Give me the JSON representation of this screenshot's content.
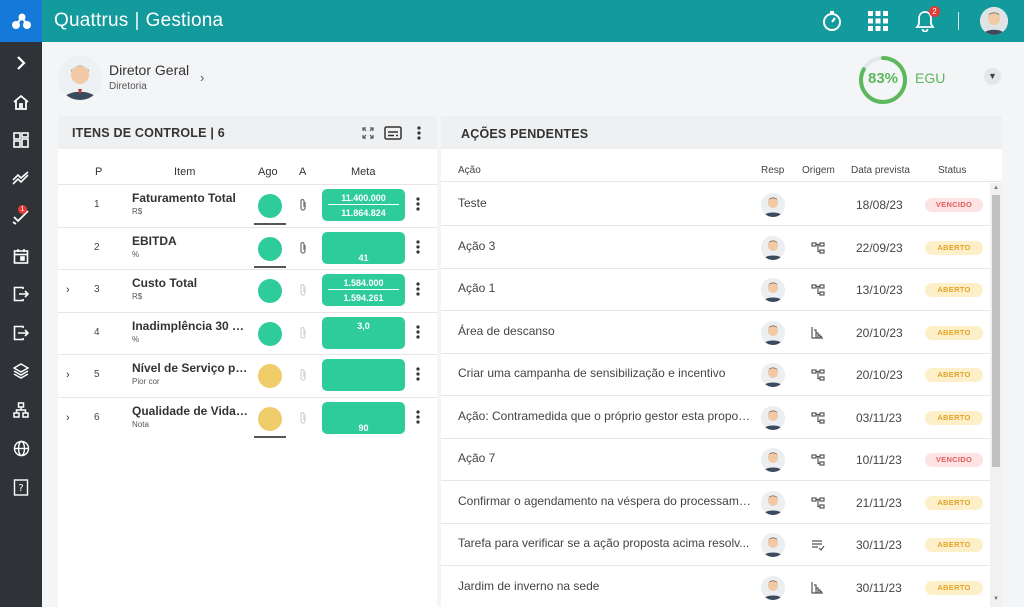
{
  "app": {
    "brand": "Quattrus",
    "module": "Gestiona",
    "notification_count": "2"
  },
  "colors": {
    "topbar": "#139a9c",
    "sidebar": "#2f3338",
    "green": "#2ecc9a",
    "yellow": "#f0cd6b",
    "gauge": "#5cb85c"
  },
  "sidebar": {
    "items": [
      {
        "icon": "chevron-right-icon"
      },
      {
        "icon": "home-icon"
      },
      {
        "icon": "dashboard-icon"
      },
      {
        "icon": "trend-icon"
      },
      {
        "icon": "check-list-icon",
        "badge": "1"
      },
      {
        "icon": "calendar-icon"
      },
      {
        "icon": "logout-icon"
      },
      {
        "icon": "login-icon"
      },
      {
        "icon": "layers-icon"
      },
      {
        "icon": "hierarchy-icon"
      },
      {
        "icon": "globe-icon"
      },
      {
        "icon": "help-book-icon"
      }
    ]
  },
  "profile": {
    "name": "Diretor Geral",
    "subtitle": "Diretoria"
  },
  "egu": {
    "percent": "83%",
    "value": 0.83,
    "label": "EGU"
  },
  "itens_controle": {
    "title": "ITENS DE CONTROLE | 6",
    "columns": {
      "p": "P",
      "item": "Item",
      "ago": "Ago",
      "a": "A",
      "meta": "Meta"
    },
    "rows": [
      {
        "expandable": false,
        "p": "1",
        "name": "Faturamento Total",
        "unit": "R$",
        "farol": "green",
        "underline": true,
        "attach": true,
        "meta_top": "11.400.000",
        "meta_bottom": "11.864.824"
      },
      {
        "expandable": false,
        "p": "2",
        "name": "EBITDA",
        "unit": "%",
        "farol": "green",
        "underline": true,
        "attach": true,
        "meta_top": "",
        "meta_bottom": "41"
      },
      {
        "expandable": true,
        "p": "3",
        "name": "Custo Total",
        "unit": "R$",
        "farol": "green",
        "underline": false,
        "attach": false,
        "meta_top": "1.584.000",
        "meta_bottom": "1.594.261"
      },
      {
        "expandable": false,
        "p": "4",
        "name": "Inadimplência 30 dias",
        "unit": "%",
        "farol": "green",
        "underline": false,
        "attach": false,
        "meta_top": "3,0",
        "meta_bottom": ""
      },
      {
        "expandable": true,
        "p": "5",
        "name": "Nível de Serviço par...",
        "unit": "Pior cor",
        "farol": "yellow",
        "underline": false,
        "attach": false,
        "meta_top": "",
        "meta_bottom": ""
      },
      {
        "expandable": true,
        "p": "6",
        "name": "Qualidade de Vida n...",
        "unit": "Nota",
        "farol": "yellow",
        "underline": true,
        "attach": false,
        "meta_top": "",
        "meta_bottom": "90"
      }
    ]
  },
  "acoes": {
    "title": "AÇÕES PENDENTES",
    "columns": {
      "acao": "Ação",
      "resp": "Resp",
      "origem": "Origem",
      "data": "Data prevista",
      "status": "Status"
    },
    "rows": [
      {
        "acao": "Teste",
        "origem": "",
        "data": "18/08/23",
        "status": "VENCIDO"
      },
      {
        "acao": "Ação 3",
        "origem": "org-chart-icon",
        "data": "22/09/23",
        "status": "ABERTO"
      },
      {
        "acao": "Ação 1",
        "origem": "org-chart-icon",
        "data": "13/10/23",
        "status": "ABERTO"
      },
      {
        "acao": "Área de descanso",
        "origem": "pareto-icon",
        "data": "20/10/23",
        "status": "ABERTO"
      },
      {
        "acao": "Criar uma campanha de sensibilização e incentivo",
        "origem": "org-chart-icon",
        "data": "20/10/23",
        "status": "ABERTO"
      },
      {
        "acao": "Ação: Contramedida que o próprio gestor esta propon...",
        "origem": "org-chart-icon",
        "data": "03/11/23",
        "status": "ABERTO"
      },
      {
        "acao": "Ação 7",
        "origem": "org-chart-icon",
        "data": "10/11/23",
        "status": "VENCIDO"
      },
      {
        "acao": "Confirmar o agendamento na véspera do processame...",
        "origem": "org-chart-icon",
        "data": "21/11/23",
        "status": "ABERTO"
      },
      {
        "acao": "Tarefa para verificar se a ação proposta acima resolv...",
        "origem": "checklist-icon",
        "data": "30/11/23",
        "status": "ABERTO"
      },
      {
        "acao": "Jardim de inverno na sede",
        "origem": "pareto-icon",
        "data": "30/11/23",
        "status": "ABERTO"
      }
    ]
  }
}
